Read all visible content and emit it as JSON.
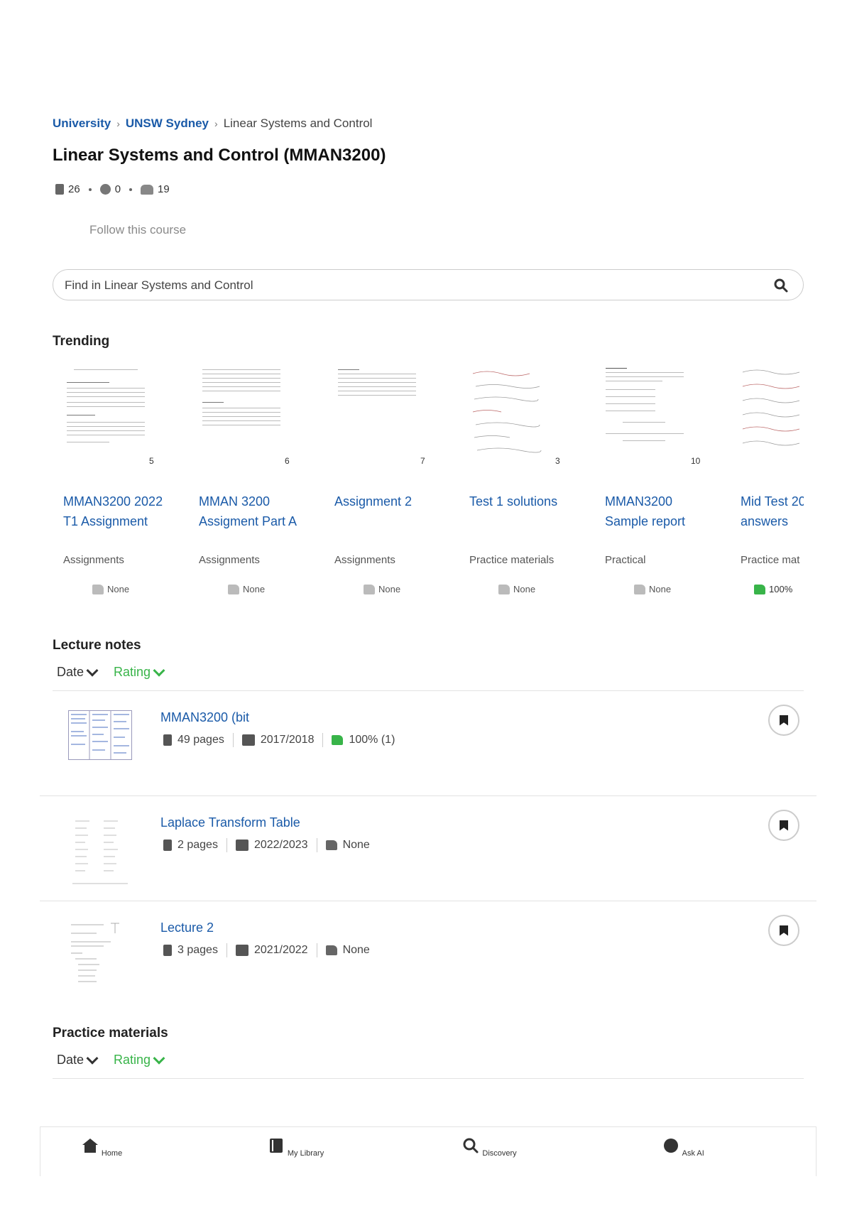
{
  "breadcrumb": {
    "items": [
      "University",
      "UNSW Sydney"
    ],
    "current": "Linear Systems and Control"
  },
  "course": {
    "title": "Linear Systems and Control (MMAN3200)",
    "stats": {
      "documents": "26",
      "questions": "0",
      "students": "19"
    },
    "follow_label": "Follow this course"
  },
  "search": {
    "placeholder": "Find in Linear Systems and Control"
  },
  "trending": {
    "heading": "Trending",
    "cards": [
      {
        "pages": "5",
        "title": "MMAN3200 2022 T1 Assignment",
        "category": "Assignments",
        "rating": "None"
      },
      {
        "pages": "6",
        "title": "MMAN 3200 Assigment Part A",
        "category": "Assignments",
        "rating": "None"
      },
      {
        "pages": "7",
        "title": "Assignment 2",
        "category": "Assignments",
        "rating": "None"
      },
      {
        "pages": "3",
        "title": "Test 1 solutions",
        "category": "Practice materials",
        "rating": "None"
      },
      {
        "pages": "10",
        "title": "MMAN3200 Sample report",
        "category": "Practical",
        "rating": "None"
      },
      {
        "pages": "",
        "title": "Mid Test 20 answers",
        "category": "Practice mat",
        "rating": "100%"
      }
    ]
  },
  "lecture_notes": {
    "heading": "Lecture notes",
    "sort": {
      "date": "Date",
      "rating": "Rating"
    },
    "items": [
      {
        "title": "MMAN3200 (bit",
        "pages": "49 pages",
        "year": "2017/2018",
        "rating": "100% (1)"
      },
      {
        "title": "Laplace Transform Table",
        "pages": "2 pages",
        "year": "2022/2023",
        "rating": "None"
      },
      {
        "title": "Lecture 2",
        "pages": "3 pages",
        "year": "2021/2022",
        "rating": "None"
      }
    ]
  },
  "practice_materials": {
    "heading": "Practice materials",
    "sort": {
      "date": "Date",
      "rating": "Rating"
    }
  },
  "bottom_nav": {
    "items": [
      {
        "label": "Home",
        "icon": "home-icon"
      },
      {
        "label": "My Library",
        "icon": "library-icon"
      },
      {
        "label": "Discovery",
        "icon": "search-icon"
      },
      {
        "label": "Ask AI",
        "icon": "ai-icon"
      }
    ]
  },
  "colors": {
    "link": "#1a5aa8",
    "positive": "#38b449",
    "muted": "#8a8a8a"
  }
}
